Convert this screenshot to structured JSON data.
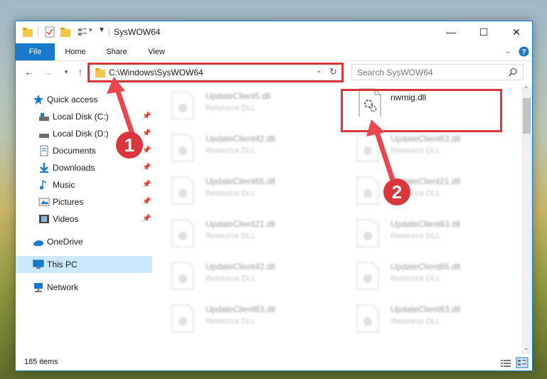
{
  "window": {
    "title": "SysWOW64"
  },
  "title_controls": {
    "minimize": "—",
    "maximize": "☐",
    "close": "✕"
  },
  "ribbon": {
    "tabs": [
      {
        "label": "File"
      },
      {
        "label": "Home"
      },
      {
        "label": "Share"
      },
      {
        "label": "View"
      }
    ]
  },
  "address_bar": {
    "path": "C:\\Windows\\SysWOW64"
  },
  "search": {
    "placeholder": "Search SysWOW64"
  },
  "sidebar": {
    "items": [
      {
        "label": "Quick access"
      },
      {
        "label": "Local Disk (C:)"
      },
      {
        "label": "Local Disk (D:)"
      },
      {
        "label": "Documents"
      },
      {
        "label": "Downloads"
      },
      {
        "label": "Music"
      },
      {
        "label": "Pictures"
      },
      {
        "label": "Videos"
      },
      {
        "label": "OneDrive"
      },
      {
        "label": "This PC"
      },
      {
        "label": "Network"
      }
    ]
  },
  "files": {
    "highlighted": {
      "name": "nwmig.dll"
    },
    "left_column": [
      {
        "name": "UpdateClient5.dll",
        "type": "Resource DLL"
      },
      {
        "name": "UpdateClient42.dll",
        "type": "Resource DLL"
      },
      {
        "name": "UpdateClient65.dll",
        "type": "Resource DLL"
      },
      {
        "name": "UpdateClient21.dll",
        "type": "Resource DLL"
      },
      {
        "name": "UpdateClient42.dll",
        "type": "Resource DLL"
      },
      {
        "name": "UpdateClient63.dll",
        "type": "Resource DLL"
      }
    ],
    "right_column": [
      {
        "name": "UpdateClient63.dll",
        "type": "Resource DLL"
      },
      {
        "name": "UpdateClient21.dll",
        "type": "Resource DLL"
      },
      {
        "name": "UpdateClient63.dll",
        "type": "Resource DLL"
      },
      {
        "name": "UpdateClient65.dll",
        "type": "Resource DLL"
      },
      {
        "name": "UpdateClient63.dll",
        "type": "Resource DLL"
      }
    ]
  },
  "annotations": {
    "step1": "1",
    "step2": "2"
  },
  "status": {
    "items_count": "185 items"
  },
  "colors": {
    "accent": "#1979ca",
    "highlight_red": "#d9363e",
    "selected_bg": "#cce8ff"
  }
}
